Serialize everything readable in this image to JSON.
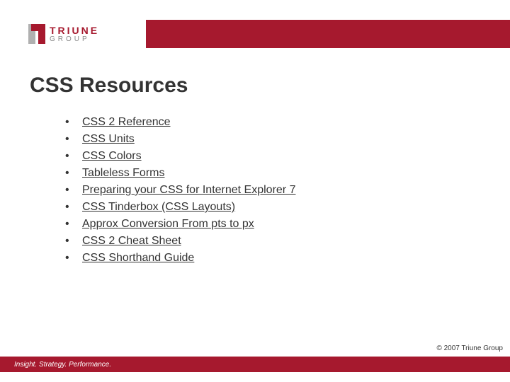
{
  "logo": {
    "word1": "TRIUNE",
    "word2": "GROUP"
  },
  "title": "CSS Resources",
  "links": [
    "CSS 2 Reference",
    "CSS Units",
    "CSS Colors",
    "Tableless Forms",
    "Preparing your CSS for Internet Explorer 7",
    "CSS Tinderbox (CSS Layouts)",
    "Approx Conversion From pts to px",
    "CSS 2 Cheat Sheet",
    "CSS Shorthand Guide"
  ],
  "copyright": "© 2007 Triune Group",
  "tagline": "Insight. Strategy. Performance."
}
